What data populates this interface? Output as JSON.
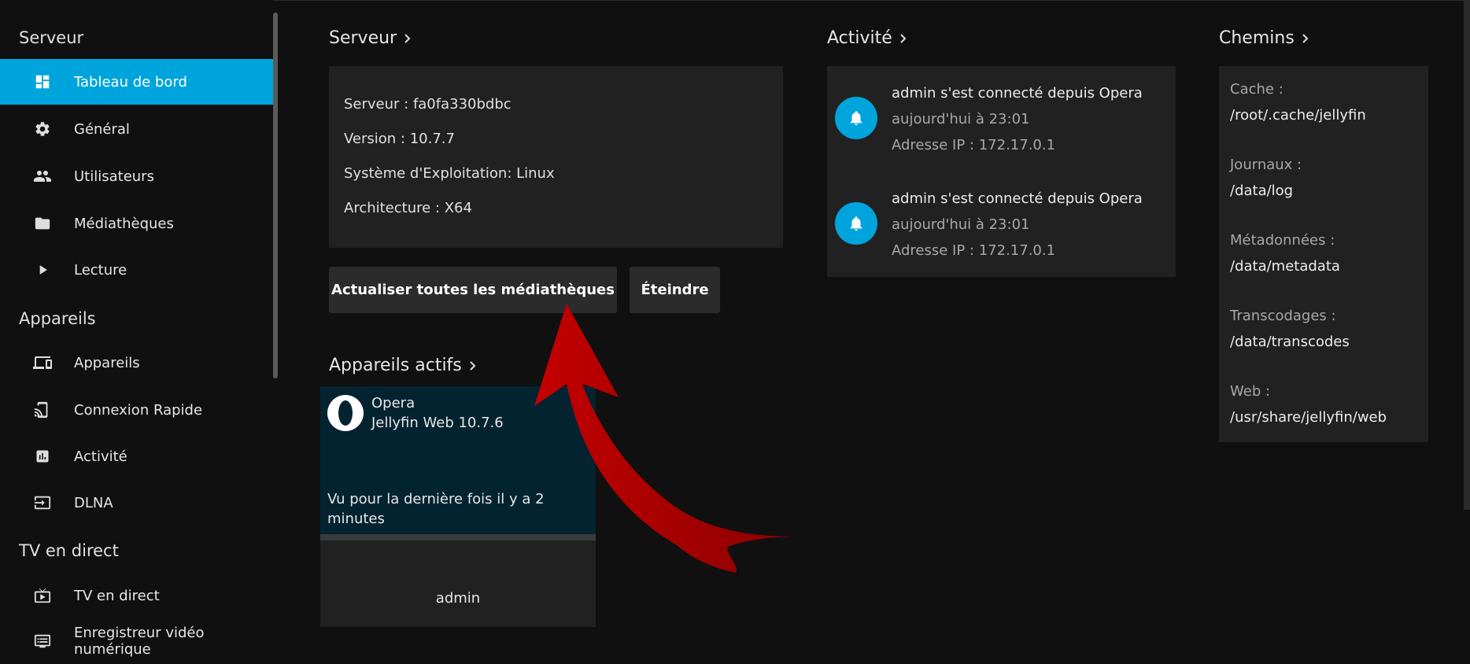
{
  "sidebar": {
    "sections": [
      {
        "title": "Serveur"
      },
      {
        "title": "Appareils"
      },
      {
        "title": "TV en direct"
      }
    ],
    "items": [
      {
        "label": "Tableau de bord",
        "icon": "dashboard-icon",
        "active": true
      },
      {
        "label": "Général",
        "icon": "gear-icon"
      },
      {
        "label": "Utilisateurs",
        "icon": "users-icon"
      },
      {
        "label": "Médiathèques",
        "icon": "folder-icon"
      },
      {
        "label": "Lecture",
        "icon": "play-icon"
      },
      {
        "label": "Appareils",
        "icon": "devices-icon"
      },
      {
        "label": "Connexion Rapide",
        "icon": "cast-icon"
      },
      {
        "label": "Activité",
        "icon": "chart-icon"
      },
      {
        "label": "DLNA",
        "icon": "input-icon"
      },
      {
        "label": "TV en direct",
        "icon": "live-tv-icon"
      },
      {
        "label": "Enregistreur vidéo numérique",
        "icon": "dvr-icon"
      }
    ]
  },
  "server": {
    "heading": "Serveur",
    "lines": [
      "Serveur : fa0fa330bdbc",
      "Version : 10.7.7",
      "Système d'Exploitation: Linux",
      "Architecture : X64"
    ],
    "refresh_button": "Actualiser toutes les médiathèques",
    "shutdown_button": "Éteindre"
  },
  "active_devices": {
    "heading": "Appareils actifs",
    "device": {
      "browser": "Opera",
      "app": "Jellyfin Web 10.7.6",
      "last_seen": [
        "Vu pour la dernière fois il y a 2",
        "minutes"
      ],
      "user": "admin"
    }
  },
  "activity": {
    "heading": "Activité",
    "entries": [
      {
        "title": "admin s'est connecté depuis Opera",
        "time": "aujourd'hui à 23:01",
        "ip": "Adresse IP : 172.17.0.1"
      },
      {
        "title": "admin s'est connecté depuis Opera",
        "time": "aujourd'hui à 23:01",
        "ip": "Adresse IP : 172.17.0.1"
      }
    ]
  },
  "paths": {
    "heading": "Chemins",
    "items": [
      {
        "label": "Cache :",
        "value": "/root/.cache/jellyfin"
      },
      {
        "label": "Journaux :",
        "value": "/data/log"
      },
      {
        "label": "Métadonnées :",
        "value": "/data/metadata"
      },
      {
        "label": "Transcodages :",
        "value": "/data/transcodes"
      },
      {
        "label": "Web :",
        "value": "/usr/share/jellyfin/web"
      }
    ]
  },
  "colors": {
    "accent": "#00a4dc",
    "annotation_arrow": "#c40000"
  }
}
